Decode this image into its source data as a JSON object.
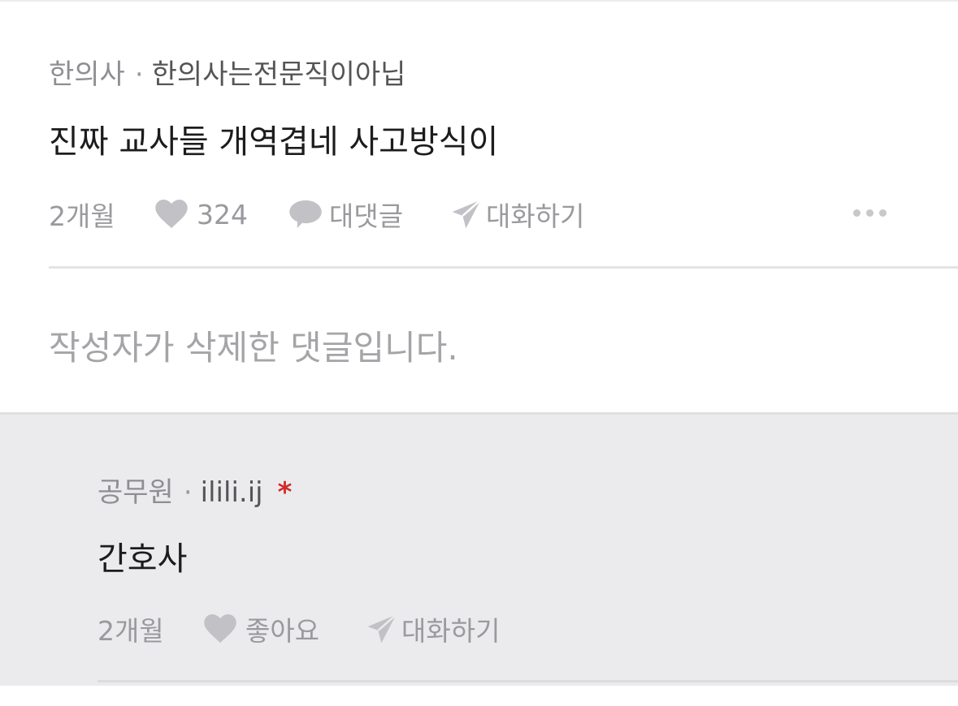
{
  "comment": {
    "job": "한의사",
    "separator": "·",
    "nickname": "한의사는전문직이아닙",
    "text": "진짜 교사들 개역겹네 사고방식이",
    "time": "2개월",
    "likes": "324",
    "reply_label": "대댓글",
    "chat_label": "대화하기"
  },
  "deleted_comment": {
    "text": "작성자가 삭제한 댓글입니다."
  },
  "reply": {
    "job": "공무원",
    "separator": "·",
    "nickname": "ilili.ij",
    "author_marker": "*",
    "text": "간호사",
    "time": "2개월",
    "like_label": "좋아요",
    "chat_label": "대화하기"
  },
  "colors": {
    "icon_gray": "#c2c2c6",
    "author_marker": "#d12a2a",
    "reply_background": "#ebebee"
  }
}
